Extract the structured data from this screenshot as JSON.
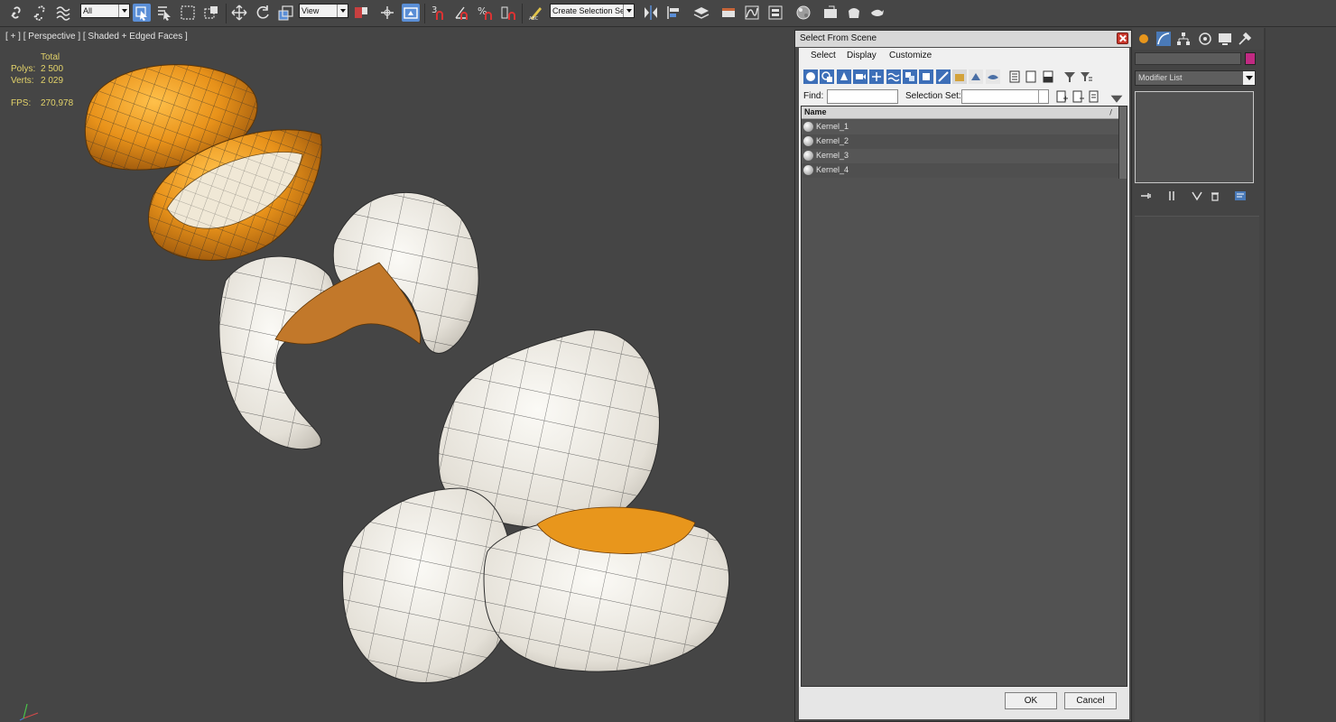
{
  "toolbar": {
    "filter_value": "All",
    "refcoord_value": "View",
    "selection_set_value": "Create Selection Se",
    "snap_label": "3"
  },
  "viewport": {
    "label": "[ + ] [ Perspective ] [ Shaded + Edged Faces ]",
    "stats": {
      "total_label": "Total",
      "polys_label": "Polys:",
      "polys_value": "2 500",
      "verts_label": "Verts:",
      "verts_value": "2 029",
      "fps_label": "FPS:",
      "fps_value": "270,978"
    }
  },
  "dialog": {
    "title": "Select From Scene",
    "menu": [
      "Select",
      "Display",
      "Customize"
    ],
    "find_label": "Find:",
    "find_value": "",
    "selection_set_label": "Selection Set:",
    "selection_set_value": "",
    "list_header": "Name",
    "sort_indicator": "/",
    "items": [
      "Kernel_1",
      "Kernel_2",
      "Kernel_3",
      "Kernel_4"
    ],
    "ok_label": "OK",
    "cancel_label": "Cancel"
  },
  "command_panel": {
    "modifier_list": "Modifier List",
    "object_color": "#c02a82"
  },
  "colors": {
    "viewport_bg": "#454545",
    "stats_text": "#e3d36a",
    "kernel_orange": "#e8961c",
    "popcorn_white": "#e9e6df",
    "active_button": "#5a8ed6"
  }
}
